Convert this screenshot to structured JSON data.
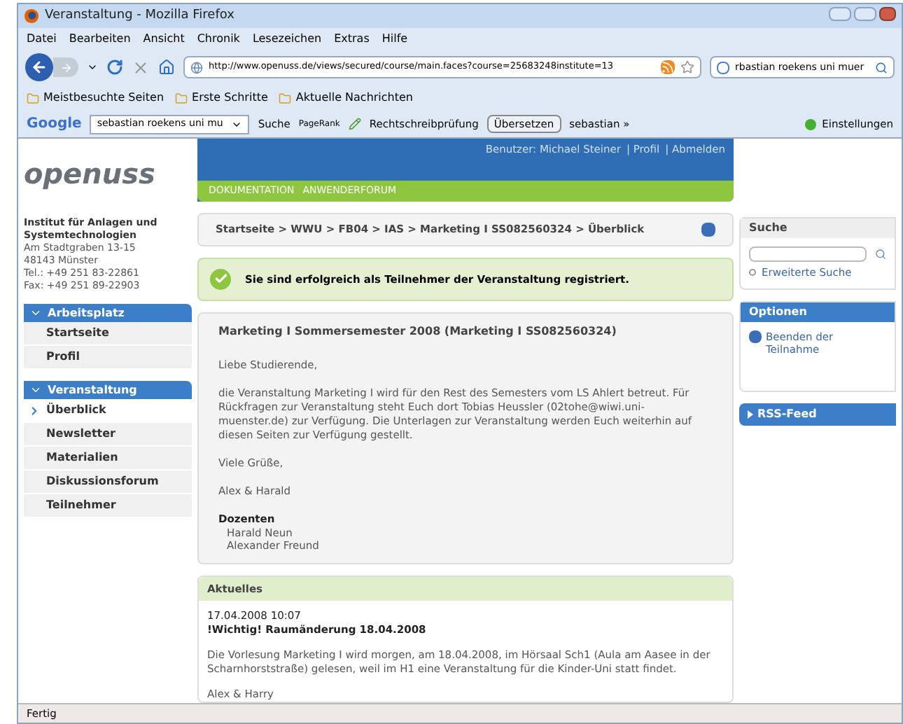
{
  "window": {
    "title": "Veranstaltung - Mozilla Firefox"
  },
  "menu": [
    "Datei",
    "Bearbeiten",
    "Ansicht",
    "Chronik",
    "Lesezeichen",
    "Extras",
    "Hilfe"
  ],
  "navbar": {
    "url": "http://www.openuss.de/views/secured/course/main.faces?course=25683248institute=13",
    "search": "rbastian roekens uni muer"
  },
  "bookmarks": [
    "Meistbesuchte Seiten",
    "Erste Schritte",
    "Aktuelle Nachrichten"
  ],
  "google_toolbar": {
    "logo": "Google",
    "query": "sebastian roekens uni mu",
    "search": "Suche",
    "pagerank": "PageRank",
    "spelling": "Rechtschreibprüfung",
    "translate": "Übersetzen",
    "user": "sebastian »",
    "settings": "Einstellungen"
  },
  "header": {
    "logo": "openuss",
    "user": "Benutzer: Michael Steiner",
    "links": [
      "| Profil",
      "| Abmelden"
    ],
    "nav": [
      "DOKUMENTATION",
      "ANWENDERFORUM"
    ]
  },
  "institute": {
    "name": "Institut für Anlagen und Systemtechnologien",
    "lines": [
      "Am Stadtgraben 13-15",
      "48143 Münster",
      "Tel.: +49 251 83-22861",
      "Fax: +49 251 89-22903"
    ]
  },
  "sidebar": [
    {
      "title": "Arbeitsplatz",
      "expanded": true,
      "items": [
        {
          "label": "Startseite",
          "selected": false
        },
        {
          "label": "Profil",
          "selected": false
        }
      ]
    },
    {
      "title": "Veranstaltung",
      "expanded": true,
      "items": [
        {
          "label": "Überblick",
          "selected": true
        },
        {
          "label": "Newsletter",
          "selected": false
        },
        {
          "label": "Materialien",
          "selected": false
        },
        {
          "label": "Diskussionsforum",
          "selected": false
        },
        {
          "label": "Teilnehmer",
          "selected": false
        }
      ]
    }
  ],
  "breadcrumb": "Startseite > WWU > FB04 > IAS > Marketing I SS082560324 > Überblick",
  "message": "Sie sind erfolgreich als Teilnehmer der Veranstaltung registriert.",
  "course": {
    "title": "Marketing I Sommersemester 2008 (Marketing I SS082560324)",
    "paragraphs": [
      "Liebe Studierende,",
      "die Veranstaltung Marketing I wird für den Rest des Semesters vom LS Ahlert betreut. Für Rückfragen zur Veranstaltung steht Euch dort Tobias Heussler (02tohe@wiwi.uni-muenster.de) zur Verfügung. Die Unterlagen zur Veranstaltung werden Euch weiterhin auf diesen Seiten zur Verfügung gestellt.",
      "Viele Grüße,",
      "Alex & Harald"
    ],
    "lecturers_heading": "Dozenten",
    "lecturers": [
      "Harald Neun",
      "Alexander Freund"
    ]
  },
  "news": {
    "heading": "Aktuelles",
    "date": "17.04.2008 10:07",
    "title": "!Wichtig! Raumänderung 18.04.2008",
    "body": "Die Vorlesung Marketing I wird morgen, am 18.04.2008, im Hörsaal Sch1 (Aula am Aasee in der Scharnhorststraße) gelesen, weil im H1 eine Veranstaltung für die Kinder-Uni statt findet.",
    "signature": "Alex & Harry"
  },
  "search_panel": {
    "heading": "Suche",
    "link": "Erweiterte Suche"
  },
  "options_panel": {
    "heading": "Optionen",
    "link": "Beenden der Teilnahme"
  },
  "rss_panel": {
    "heading": "RSS-Feed",
    "expanded": false
  },
  "status_bar": "Fertig"
}
